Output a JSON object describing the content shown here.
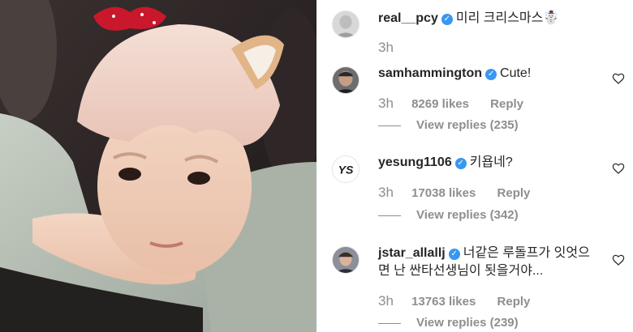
{
  "photo": {
    "description_icon": "selfie-photo"
  },
  "comments": [
    {
      "username": "real__pcy",
      "verified_icon": "verified-badge-icon",
      "text": "미리 크리스마스☃️",
      "time": "3h",
      "likes": "",
      "reply": "",
      "view_replies": "",
      "avatar": "avatar-real-pcy"
    },
    {
      "username": "samhammington",
      "verified_icon": "verified-badge-icon",
      "text": "Cute!",
      "time": "3h",
      "likes": "8269 likes",
      "reply": "Reply",
      "view_replies": "View replies (235)",
      "avatar": "avatar-samhammington"
    },
    {
      "username": "yesung1106",
      "verified_icon": "verified-badge-icon",
      "text": "키욥네?",
      "time": "3h",
      "likes": "17038 likes",
      "reply": "Reply",
      "view_replies": "View replies (342)",
      "avatar": "avatar-yesung1106",
      "avatar_text": "YS"
    },
    {
      "username": "jstar_allallj",
      "verified_icon": "verified-badge-icon",
      "text": "너같은 루돌프가 잇엇으면 난 싼타선생님이 됫을거야...",
      "time": "3h",
      "likes": "13763 likes",
      "reply": "Reply",
      "view_replies": "View replies (239)",
      "avatar": "avatar-jstar-allallj"
    }
  ],
  "colors": {
    "verified": "#3897f0",
    "muted": "#8e8e8e",
    "text": "#262626"
  },
  "verified_mark": "✓"
}
